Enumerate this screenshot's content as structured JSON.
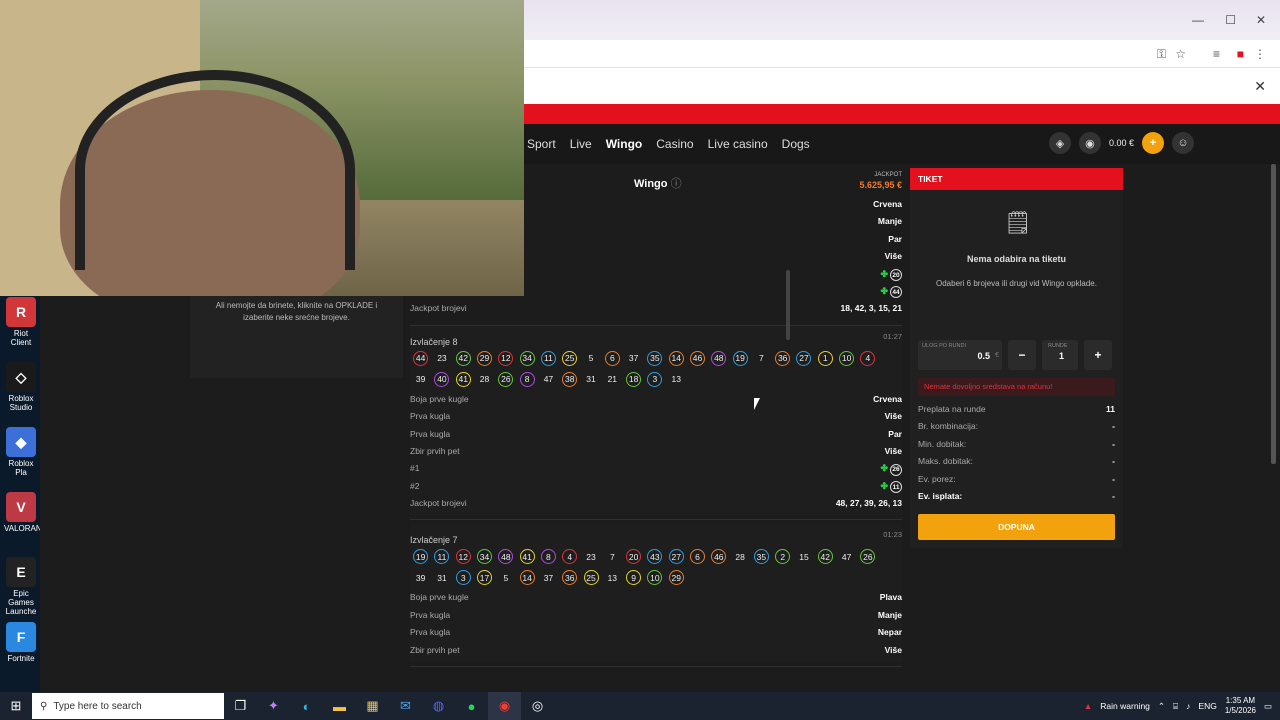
{
  "desktop": {
    "icons": [
      {
        "label": "Riot Client",
        "color": "#d13639",
        "glyph": "R"
      },
      {
        "label": "Roblox Studio",
        "color": "#1a1a1a",
        "glyph": "◇"
      },
      {
        "label": "Roblox Pla",
        "color": "#3c6fd8",
        "glyph": "◆"
      },
      {
        "label": "VALORANT",
        "color": "#bd3944",
        "glyph": "V"
      },
      {
        "label": "Epic Games Launche",
        "color": "#222",
        "glyph": "E"
      },
      {
        "label": "Fortnite",
        "color": "#2a88e0",
        "glyph": "F"
      }
    ]
  },
  "browser": {
    "window_controls": {
      "minimize": "—",
      "maximize": "☐",
      "close": "✕"
    },
    "notification_close": "✕",
    "nav": {
      "links": [
        "Sport",
        "Live",
        "Wingo",
        "Casino",
        "Live casino",
        "Dogs"
      ],
      "active": "Wingo",
      "balance": "0.00 €",
      "plus": "+"
    }
  },
  "wingo": {
    "title": "Wingo",
    "jackpot_label": "JACKPOT",
    "jackpot_value": "5.625,95 €",
    "notice_text": "Ali nemojte da brinete, kliknite na OPKLADE i izaberite neke srećne brojeve.",
    "prev_rows": [
      {
        "label": "",
        "value": "Crvena"
      },
      {
        "label": "",
        "value": "Manje"
      },
      {
        "label": "",
        "value": "Par"
      },
      {
        "label": "",
        "value": "Više"
      },
      {
        "label": "",
        "value": "20",
        "clover": true
      },
      {
        "label": "",
        "value": "44",
        "clover": true
      }
    ],
    "prev_jackpot": {
      "label": "Jackpot brojevi",
      "value": "18, 42, 3, 15, 21"
    },
    "draws": [
      {
        "title": "Izvlačenje 8",
        "time": "01:27",
        "balls": [
          {
            "n": "44",
            "c": "#e4303a"
          },
          {
            "n": "23",
            "c": "#1e1e1e"
          },
          {
            "n": "42",
            "c": "#5fc83c"
          },
          {
            "n": "29",
            "c": "#e97d2c"
          },
          {
            "n": "12",
            "c": "#e4303a"
          },
          {
            "n": "34",
            "c": "#5fc83c"
          },
          {
            "n": "11",
            "c": "#2f9ee0"
          },
          {
            "n": "25",
            "c": "#e6d22a"
          },
          {
            "n": "5",
            "c": "#1e1e1e"
          },
          {
            "n": "6",
            "c": "#e97d2c"
          },
          {
            "n": "37",
            "c": "#1e1e1e"
          },
          {
            "n": "35",
            "c": "#2f9ee0"
          },
          {
            "n": "14",
            "c": "#e97d2c"
          },
          {
            "n": "46",
            "c": "#e97d2c"
          },
          {
            "n": "48",
            "c": "#b04be0"
          },
          {
            "n": "19",
            "c": "#2f9ee0"
          },
          {
            "n": "7",
            "c": "#1e1e1e"
          },
          {
            "n": "36",
            "c": "#e97d2c"
          },
          {
            "n": "27",
            "c": "#2f9ee0"
          },
          {
            "n": "1",
            "c": "#e6d22a"
          },
          {
            "n": "10",
            "c": "#5fc83c"
          },
          {
            "n": "4",
            "c": "#e4303a"
          },
          {
            "n": "39",
            "c": "#1e1e1e"
          },
          {
            "n": "40",
            "c": "#b04be0"
          },
          {
            "n": "41",
            "c": "#e6d22a"
          },
          {
            "n": "28",
            "c": "#1e1e1e"
          },
          {
            "n": "26",
            "c": "#5fc83c"
          },
          {
            "n": "8",
            "c": "#b04be0"
          },
          {
            "n": "47",
            "c": "#1e1e1e"
          },
          {
            "n": "38",
            "c": "#e97d2c"
          },
          {
            "n": "31",
            "c": "#1e1e1e"
          },
          {
            "n": "21",
            "c": "#1e1e1e"
          },
          {
            "n": "18",
            "c": "#5fc83c"
          },
          {
            "n": "3",
            "c": "#2f9ee0"
          },
          {
            "n": "13",
            "c": "#1e1e1e"
          }
        ],
        "rows": [
          {
            "label": "Boja prve kugle",
            "value": "Crvena"
          },
          {
            "label": "Prva kugla",
            "value": "Više"
          },
          {
            "label": "Prva kugla",
            "value": "Par"
          },
          {
            "label": "Zbir prvih pet",
            "value": "Više"
          },
          {
            "label": "#1",
            "value": "26",
            "clover": true
          },
          {
            "label": "#2",
            "value": "11",
            "clover": true
          }
        ],
        "jackpot": {
          "label": "Jackpot brojevi",
          "value": "48, 27, 39, 26, 13"
        }
      },
      {
        "title": "Izvlačenje 7",
        "time": "01:23",
        "balls": [
          {
            "n": "19",
            "c": "#2f9ee0"
          },
          {
            "n": "11",
            "c": "#2f9ee0"
          },
          {
            "n": "12",
            "c": "#e4303a"
          },
          {
            "n": "34",
            "c": "#5fc83c"
          },
          {
            "n": "48",
            "c": "#b04be0"
          },
          {
            "n": "41",
            "c": "#e6d22a"
          },
          {
            "n": "8",
            "c": "#b04be0"
          },
          {
            "n": "4",
            "c": "#e4303a"
          },
          {
            "n": "23",
            "c": "#1e1e1e"
          },
          {
            "n": "7",
            "c": "#1e1e1e"
          },
          {
            "n": "20",
            "c": "#e4303a"
          },
          {
            "n": "43",
            "c": "#2f9ee0"
          },
          {
            "n": "27",
            "c": "#2f9ee0"
          },
          {
            "n": "6",
            "c": "#e97d2c"
          },
          {
            "n": "46",
            "c": "#e97d2c"
          },
          {
            "n": "28",
            "c": "#1e1e1e"
          },
          {
            "n": "35",
            "c": "#2f9ee0"
          },
          {
            "n": "2",
            "c": "#5fc83c"
          },
          {
            "n": "15",
            "c": "#1e1e1e"
          },
          {
            "n": "42",
            "c": "#5fc83c"
          },
          {
            "n": "47",
            "c": "#1e1e1e"
          },
          {
            "n": "26",
            "c": "#5fc83c"
          },
          {
            "n": "39",
            "c": "#1e1e1e"
          },
          {
            "n": "31",
            "c": "#1e1e1e"
          },
          {
            "n": "3",
            "c": "#2f9ee0"
          },
          {
            "n": "17",
            "c": "#e6d22a"
          },
          {
            "n": "5",
            "c": "#1e1e1e"
          },
          {
            "n": "14",
            "c": "#e97d2c"
          },
          {
            "n": "37",
            "c": "#1e1e1e"
          },
          {
            "n": "36",
            "c": "#e97d2c"
          },
          {
            "n": "25",
            "c": "#e6d22a"
          },
          {
            "n": "13",
            "c": "#1e1e1e"
          },
          {
            "n": "9",
            "c": "#e6d22a"
          },
          {
            "n": "10",
            "c": "#5fc83c"
          },
          {
            "n": "29",
            "c": "#e97d2c"
          }
        ],
        "rows": [
          {
            "label": "Boja prve kugle",
            "value": "Plava"
          },
          {
            "label": "Prva kugla",
            "value": "Manje"
          },
          {
            "label": "Prva kugla",
            "value": "Nepar"
          },
          {
            "label": "Zbir prvih pet",
            "value": "Više"
          }
        ]
      }
    ]
  },
  "ticket": {
    "header": "TIKET",
    "empty_title": "Nema odabira na tiketu",
    "hint": "Odaberi 6 brojeva ili drugi vid Wingo opklade.",
    "stake_label": "ULOG PO RUNDI",
    "stake_value": "0.5",
    "currency": "€",
    "minus": "−",
    "rounds_label": "RUNDE",
    "rounds_value": "1",
    "plus": "+",
    "warning": "Nemate dovoljno sredstava na računu!",
    "summary": [
      {
        "label": "Preplata na runde",
        "value": "11"
      },
      {
        "label": "Br. kombinacija:",
        "value": "-"
      },
      {
        "label": "Min. dobitak:",
        "value": "-"
      },
      {
        "label": "Maks. dobitak:",
        "value": "-"
      },
      {
        "label": "Ev. porez:",
        "value": "-"
      },
      {
        "label": "Ev. isplata:",
        "value": "-",
        "bold": true
      }
    ],
    "button": "DOPUNA"
  },
  "taskbar": {
    "search_placeholder": "Type here to search",
    "weather": "Rain warning",
    "lang": "ENG",
    "time": "1:35 AM",
    "date": "1/5/2026"
  }
}
